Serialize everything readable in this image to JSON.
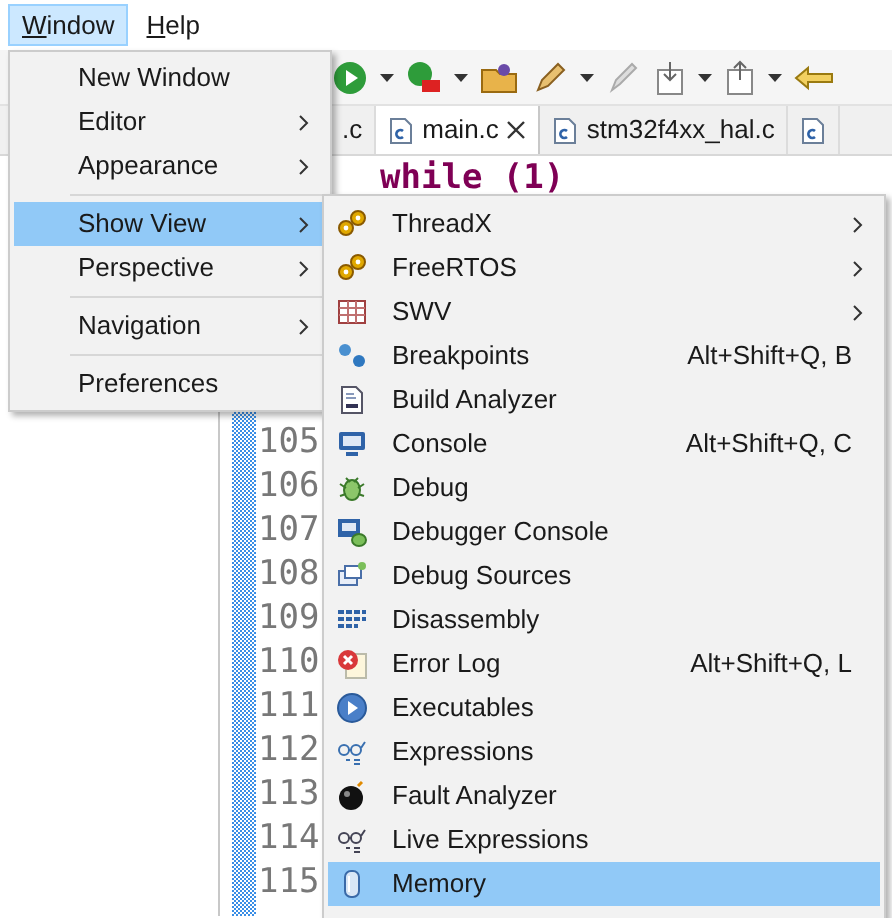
{
  "menubar": [
    {
      "label": "Window",
      "selected": true
    },
    {
      "label": "Help",
      "selected": false
    }
  ],
  "editor": {
    "tabs": [
      {
        "label": ".c",
        "selected": false,
        "closable": false,
        "icon": false
      },
      {
        "label": "main.c",
        "selected": true,
        "closable": true,
        "icon": true
      },
      {
        "label": "stm32f4xx_hal.c",
        "selected": false,
        "closable": false,
        "icon": true
      },
      {
        "selected": false,
        "closable": false,
        "icon": true
      }
    ],
    "code_line": "while (1)",
    "line_numbers": [
      "105",
      "106",
      "107",
      "108",
      "109",
      "110",
      "111",
      "112",
      "113",
      "114",
      "115"
    ]
  },
  "window_menu": [
    {
      "kind": "item",
      "label": "New Window",
      "submenu": false,
      "selected": false
    },
    {
      "kind": "item",
      "label": "Editor",
      "submenu": true,
      "selected": false
    },
    {
      "kind": "item",
      "label": "Appearance",
      "submenu": true,
      "selected": false
    },
    {
      "kind": "separator"
    },
    {
      "kind": "item",
      "label": "Show View",
      "submenu": true,
      "selected": true
    },
    {
      "kind": "item",
      "label": "Perspective",
      "submenu": true,
      "selected": false
    },
    {
      "kind": "separator"
    },
    {
      "kind": "item",
      "label": "Navigation",
      "submenu": true,
      "selected": false
    },
    {
      "kind": "separator"
    },
    {
      "kind": "item",
      "label": "Preferences",
      "submenu": false,
      "selected": false
    }
  ],
  "show_view_menu": [
    {
      "label": "ThreadX",
      "submenu": true,
      "selected": false
    },
    {
      "label": "FreeRTOS",
      "submenu": true,
      "selected": false
    },
    {
      "label": "SWV",
      "submenu": true,
      "selected": false
    },
    {
      "label": "Breakpoints",
      "shortcut": "Alt+Shift+Q, B",
      "submenu": false,
      "selected": false
    },
    {
      "label": "Build Analyzer",
      "submenu": false,
      "selected": false
    },
    {
      "label": "Console",
      "shortcut": "Alt+Shift+Q, C",
      "submenu": false,
      "selected": false
    },
    {
      "label": "Debug",
      "submenu": false,
      "selected": false
    },
    {
      "label": "Debugger Console",
      "submenu": false,
      "selected": false
    },
    {
      "label": "Debug Sources",
      "submenu": false,
      "selected": false
    },
    {
      "label": "Disassembly",
      "submenu": false,
      "selected": false
    },
    {
      "label": "Error Log",
      "shortcut": "Alt+Shift+Q, L",
      "submenu": false,
      "selected": false
    },
    {
      "label": "Executables",
      "submenu": false,
      "selected": false
    },
    {
      "label": "Expressions",
      "submenu": false,
      "selected": false
    },
    {
      "label": "Fault Analyzer",
      "submenu": false,
      "selected": false
    },
    {
      "label": "Live Expressions",
      "submenu": false,
      "selected": false
    },
    {
      "label": "Memory",
      "submenu": false,
      "selected": true
    }
  ]
}
